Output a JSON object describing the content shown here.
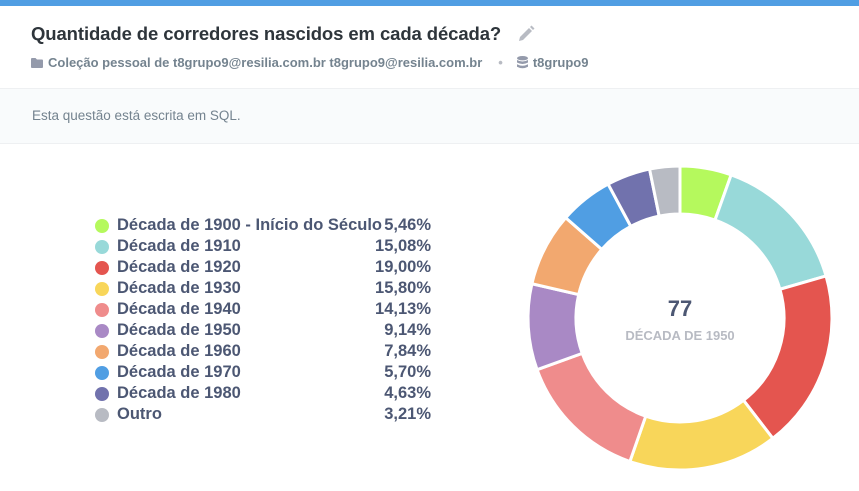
{
  "header": {
    "title": "Quantidade de corredores nascidos em cada década?",
    "collection": "Coleção pessoal de t8grupo9@resilia.com.br t8grupo9@resilia.com.br",
    "database": "t8grupo9"
  },
  "sql_notice": "Esta questão está escrita em SQL.",
  "center": {
    "value": "77",
    "label": "DÉCADA DE 1950"
  },
  "chart_data": {
    "type": "pie",
    "categories": [
      "Década de 1900 - Início do Século",
      "Década de 1910",
      "Década de 1920",
      "Década de 1930",
      "Década de 1940",
      "Década de 1950",
      "Década de 1960",
      "Década de 1970",
      "Década de 1980",
      "Outro"
    ],
    "values": [
      5.46,
      15.08,
      19.0,
      15.8,
      14.13,
      9.14,
      7.84,
      5.7,
      4.63,
      3.21
    ],
    "labels": [
      "5,46%",
      "15,08%",
      "19,00%",
      "15,80%",
      "14,13%",
      "9,14%",
      "7,84%",
      "5,70%",
      "4,63%",
      "3,21%"
    ],
    "colors": [
      "#b5f95d",
      "#98d9d9",
      "#e4554f",
      "#f8d65a",
      "#ef8c8c",
      "#a989c5",
      "#f2a86f",
      "#509ee3",
      "#7172ad",
      "#b8bbc3"
    ],
    "legend_position": "left"
  }
}
